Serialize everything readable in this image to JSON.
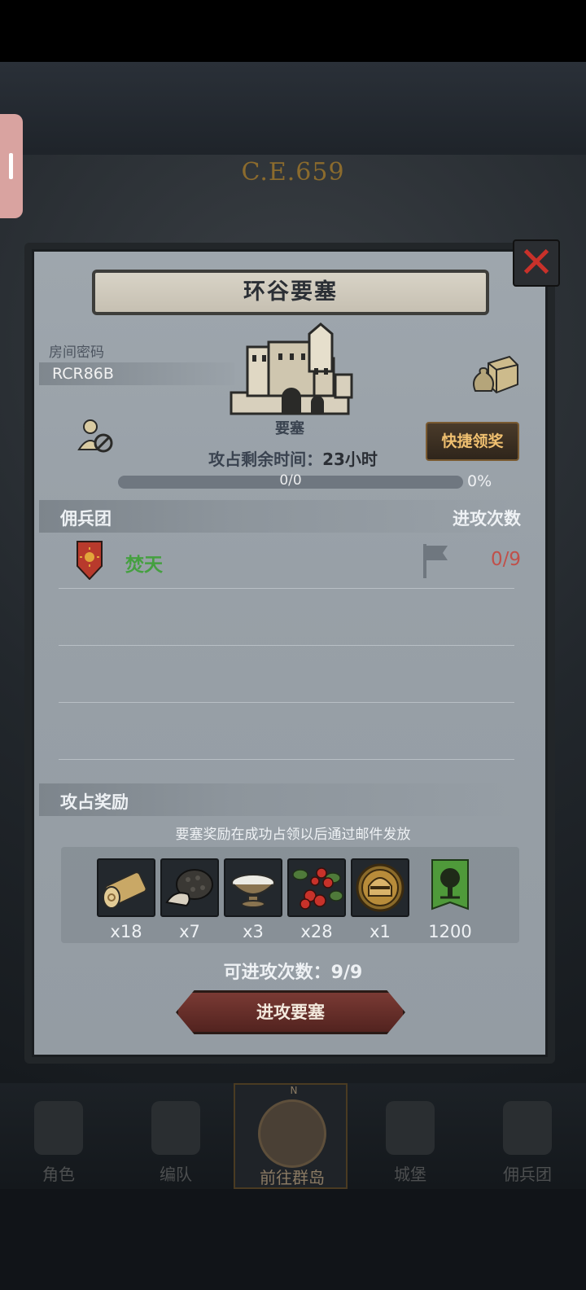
{
  "background": {
    "year": "C.E.659"
  },
  "dialog": {
    "title": "环谷要塞",
    "room_label": "房间密码",
    "room_code": "RCR86B",
    "castle_label": "要塞",
    "quick_claim": "快捷领奖",
    "remaining_label": "攻占剩余时间：",
    "remaining_value": "23小时",
    "progress_text": "0/0",
    "progress_percent": "0%",
    "progress_fraction": 0,
    "mercenary_header": "佣兵团",
    "attack_times_header": "进攻次数",
    "guilds": [
      {
        "name": "焚天",
        "attacks": "0/9"
      }
    ],
    "rewards_header": "攻占奖励",
    "rewards_note": "要塞奖励在成功占领以后通过邮件发放",
    "rewards": [
      {
        "icon": "wood-log-icon",
        "qty": "x18"
      },
      {
        "icon": "truffle-icon",
        "qty": "x7"
      },
      {
        "icon": "salt-bowl-icon",
        "qty": "x3"
      },
      {
        "icon": "berries-icon",
        "qty": "x28"
      },
      {
        "icon": "knight-helmet-icon",
        "qty": "x1"
      },
      {
        "icon": "green-tree-banner-icon",
        "qty": "1200"
      }
    ],
    "available_attacks_label": "可进攻次数：",
    "available_attacks_value": "9/9",
    "attack_button": "进攻要塞"
  },
  "bottom_nav": [
    {
      "label": "角色",
      "icon": "knight-icon"
    },
    {
      "label": "编队",
      "icon": "helmet-squad-icon"
    },
    {
      "label": "前往群岛",
      "icon": "compass-icon",
      "active": true,
      "compass_letter": "N"
    },
    {
      "label": "城堡",
      "icon": "castle-icon"
    },
    {
      "label": "佣兵团",
      "icon": "ship-icon"
    }
  ],
  "colors": {
    "panel": "#98a0a7",
    "accent_green": "#45a040",
    "accent_red": "#c0504a",
    "gold": "#f0c070"
  }
}
